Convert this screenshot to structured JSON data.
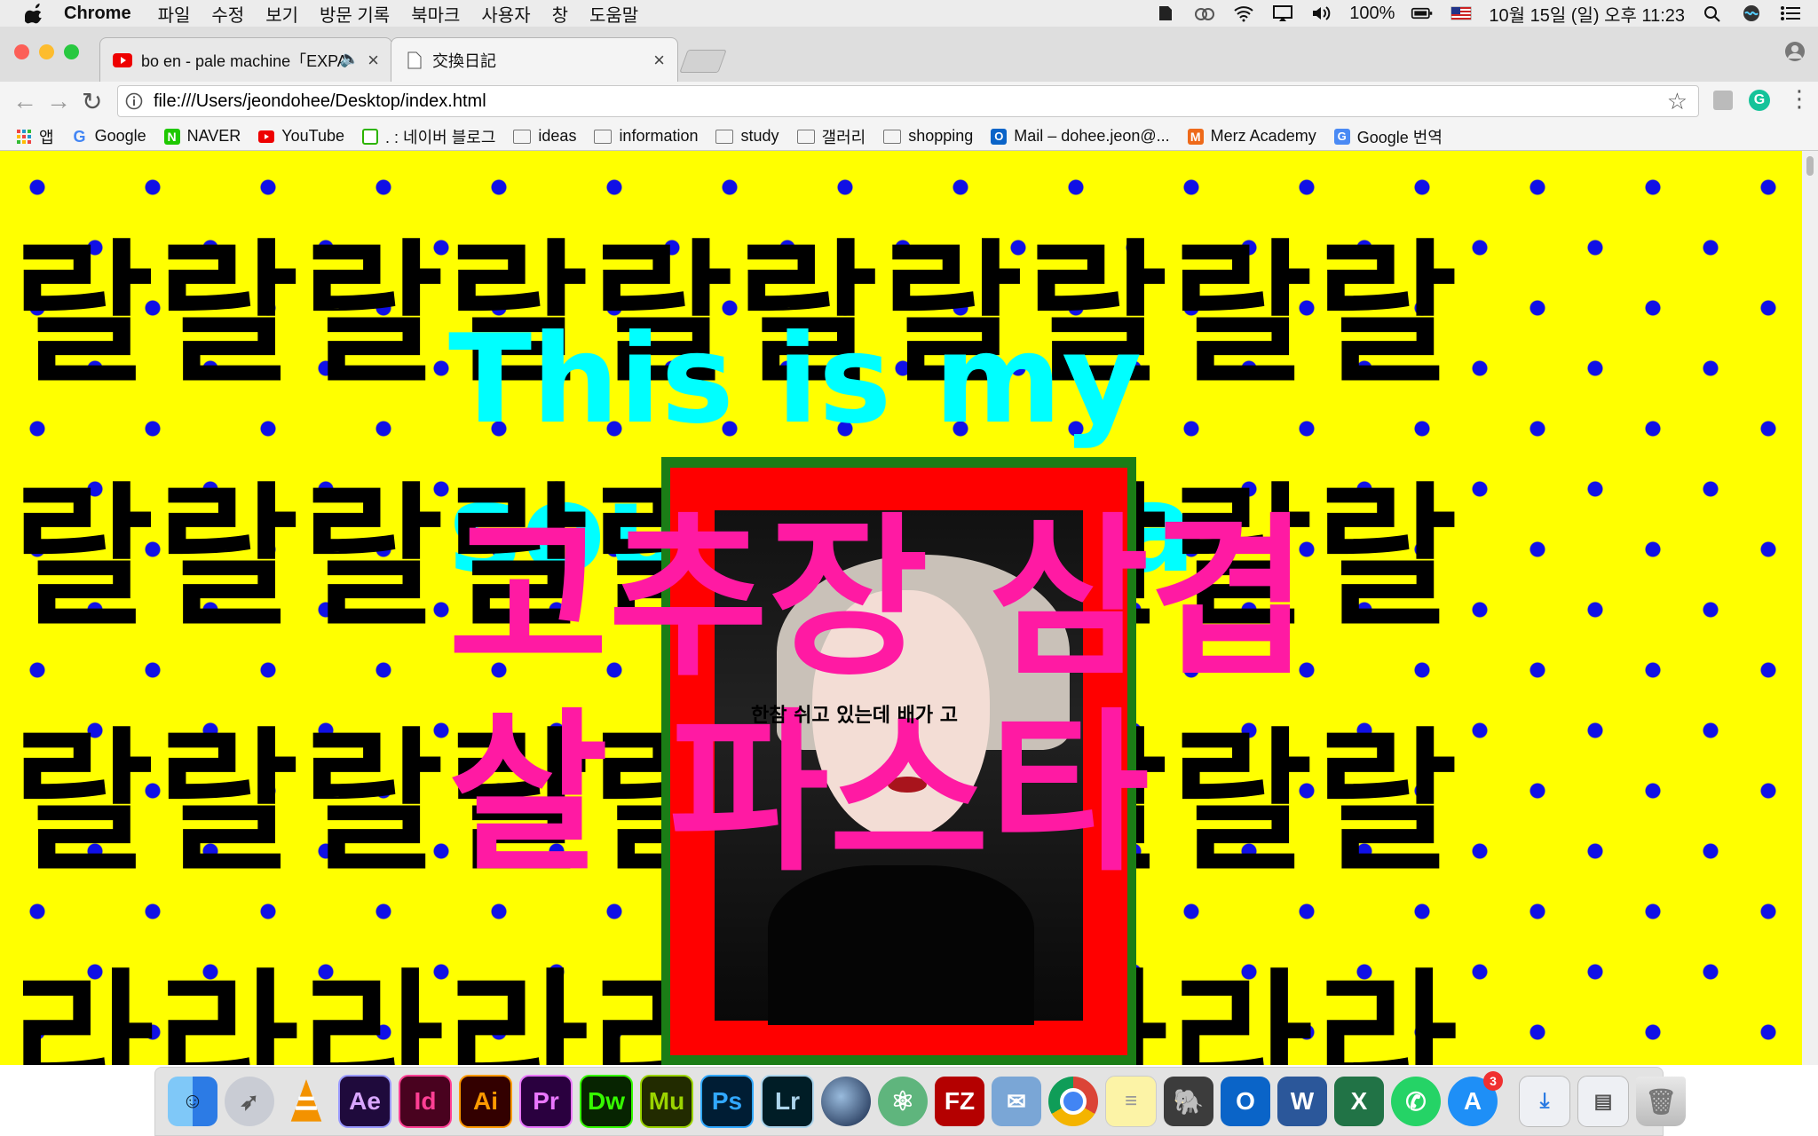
{
  "menubar": {
    "app_name": "Chrome",
    "menus": [
      "파일",
      "수정",
      "보기",
      "방문 기록",
      "북마크",
      "사용자",
      "창",
      "도움말"
    ],
    "battery": "100%",
    "clock": "10월 15일 (일) 오후 11:23"
  },
  "tabs": [
    {
      "title": "bo en - pale machine「EXPA",
      "icon": "youtube-icon"
    },
    {
      "title": "交換日記",
      "icon": "document-icon"
    }
  ],
  "address_bar": {
    "url": "file:///Users/jeondohee/Desktop/index.html"
  },
  "bookmarks": [
    {
      "label": "앱",
      "icon": "apps-grid-icon"
    },
    {
      "label": "Google",
      "icon": "google-icon"
    },
    {
      "label": "NAVER",
      "icon": "naver-icon"
    },
    {
      "label": "YouTube",
      "icon": "youtube-icon"
    },
    {
      "label": ". : 네이버 블로그",
      "icon": "blog-icon"
    },
    {
      "label": "ideas",
      "icon": "folder-icon"
    },
    {
      "label": "information",
      "icon": "folder-icon"
    },
    {
      "label": "study",
      "icon": "folder-icon"
    },
    {
      "label": "갤러리",
      "icon": "folder-icon"
    },
    {
      "label": "shopping",
      "icon": "folder-icon"
    },
    {
      "label": "Mail – dohee.jeon@...",
      "icon": "outlook-icon"
    },
    {
      "label": "Merz Academy",
      "icon": "merz-icon"
    },
    {
      "label": "Google 번역",
      "icon": "translate-icon"
    }
  ],
  "webpage": {
    "rows": [
      "랄랄랄랄랄랄랄랄랄랄",
      "랄랄랄랄랄랄랄랄랄랄",
      "랄랄랄랄랄랄랄랄랄랄",
      "라라라라라라라라라라"
    ],
    "cyan_text": "This is my sour ponta",
    "pink_text": "고추장 삼겹살 파스타",
    "caption": "한참 쉬고 있는데 배가 고"
  },
  "colors": {
    "background": "#ffff00",
    "dots": "#1010e6",
    "pink": "#ff1aa3",
    "cyan": "#00ffff",
    "frame_green": "#1b7d16",
    "frame_red": "#ff0000"
  },
  "dock": {
    "apps": [
      {
        "name": "Finder",
        "label": ""
      },
      {
        "name": "Launchpad",
        "label": ""
      },
      {
        "name": "VLC",
        "label": ""
      },
      {
        "name": "After Effects",
        "label": "Ae"
      },
      {
        "name": "InDesign",
        "label": "Id"
      },
      {
        "name": "Illustrator",
        "label": "Ai"
      },
      {
        "name": "Premiere",
        "label": "Pr"
      },
      {
        "name": "Dreamweaver",
        "label": "Dw"
      },
      {
        "name": "Muse",
        "label": "Mu"
      },
      {
        "name": "Photoshop",
        "label": "Ps"
      },
      {
        "name": "Lightroom",
        "label": "Lr"
      },
      {
        "name": "Cinema 4D",
        "label": ""
      },
      {
        "name": "Atom",
        "label": ""
      },
      {
        "name": "FileZilla",
        "label": "FZ"
      },
      {
        "name": "Preview",
        "label": ""
      },
      {
        "name": "Chrome",
        "label": ""
      },
      {
        "name": "Notes",
        "label": ""
      },
      {
        "name": "Evernote",
        "label": ""
      },
      {
        "name": "Outlook",
        "label": "O"
      },
      {
        "name": "Word",
        "label": "W"
      },
      {
        "name": "Excel",
        "label": "X"
      },
      {
        "name": "WhatsApp",
        "label": ""
      },
      {
        "name": "App Store",
        "label": "",
        "badge": "3"
      },
      {
        "name": "Downloads",
        "label": ""
      },
      {
        "name": "Documents",
        "label": ""
      },
      {
        "name": "Trash",
        "label": ""
      }
    ]
  }
}
